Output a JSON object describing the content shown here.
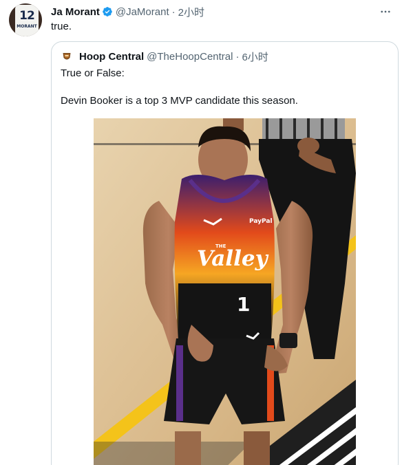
{
  "tweet": {
    "author_name": "Ja Morant",
    "author_handle": "@JaMorant",
    "separator": "·",
    "time": "2小时",
    "text": "true.",
    "avatar": {
      "jersey_number": "12",
      "jersey_name": "MORANT"
    },
    "verified_icon": "verified-badge-icon",
    "more_icon": "more-options-icon"
  },
  "quoted": {
    "author_name": "Hoop Central",
    "author_handle": "@TheHoopCentral",
    "separator": "·",
    "time": "6小时",
    "line1": "True or False:",
    "line2": "Devin Booker is a top 3 MVP candidate this season.",
    "image": {
      "jersey_wordmark_small": "THE",
      "jersey_wordmark": "Valley",
      "jersey_number": "1",
      "jersey_sponsor": "PayPal"
    }
  },
  "colors": {
    "text": "#0f1419",
    "secondary": "#536471",
    "verified": "#1d9bf0",
    "border": "#cfd9de"
  }
}
